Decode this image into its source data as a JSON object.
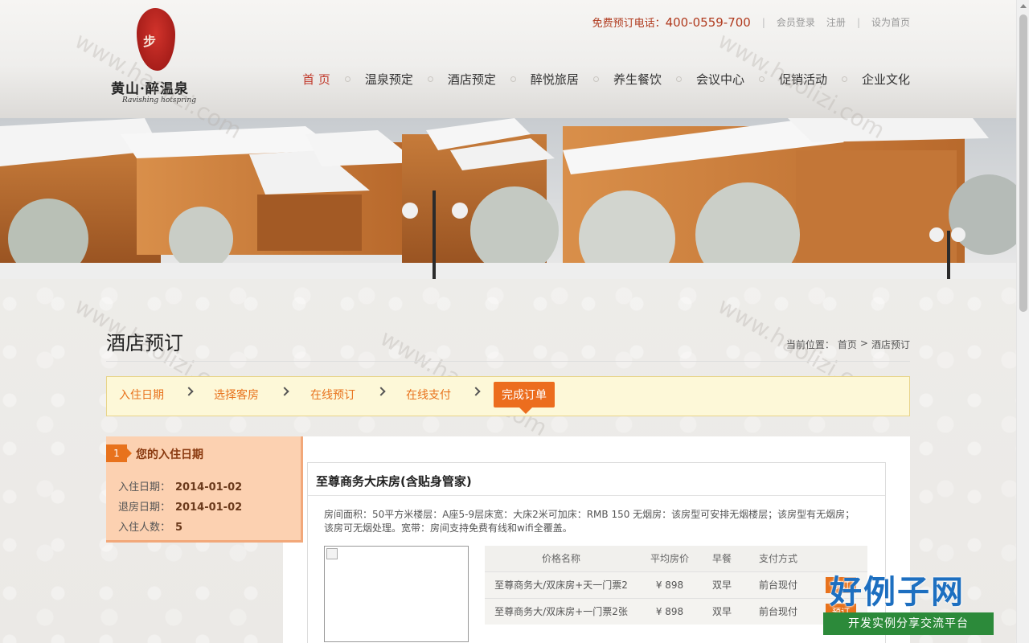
{
  "header": {
    "logo_seal_text": "步",
    "logo_cn": "黄山·醉温泉",
    "logo_en": "Ravishing hotspring",
    "hotline_label": "免费预订电话：",
    "hotline_number": "400-0559-700",
    "links": [
      "会员登录",
      "注册",
      "设为首页"
    ],
    "nav": [
      "首 页",
      "温泉预定",
      "酒店预定",
      "醉悦旅居",
      "养生餐饮",
      "会议中心",
      "促销活动",
      "企业文化"
    ],
    "nav_active": 0
  },
  "page": {
    "title": "酒店预订",
    "breadcrumb_label": "当前位置：",
    "breadcrumb_home": "首页",
    "breadcrumb_sep": ">",
    "breadcrumb_current": "酒店预订"
  },
  "steps": [
    "入住日期",
    "选择客房",
    "在线预订",
    "在线支付",
    "完成订单"
  ],
  "sidebar": {
    "number": "1",
    "title": "您的入住日期",
    "rows": [
      {
        "label": "入住日期：",
        "value": "2014-01-02"
      },
      {
        "label": "退房日期：",
        "value": "2014-01-02"
      },
      {
        "label": "入住人数：",
        "value": "5"
      }
    ]
  },
  "room": {
    "name": "至尊商务大床房(含贴身管家)",
    "description": "房间面积：50平方米楼层：A座5-9层床宽：大床2米可加床：RMB 150 无烟房：该房型可安排无烟楼层；该房型有无烟房；该房可无烟处理。宽带：房间支持免费有线和wifi全覆盖。",
    "table_headers": [
      "价格名称",
      "平均房价",
      "早餐",
      "支付方式",
      ""
    ],
    "rows": [
      {
        "name": "至尊商务大/双床房+天一门票2",
        "price": "¥ 898",
        "breakfast": "双早",
        "payment": "前台现付",
        "action": "预订"
      },
      {
        "name": "至尊商务大/双床房+一门票2张",
        "price": "¥ 898",
        "breakfast": "双早",
        "payment": "前台现付",
        "action": "预订"
      }
    ]
  },
  "watermark": "www.haolizi.com",
  "badge": {
    "top": "好例子网",
    "bottom": "开发实例分享交流平台"
  },
  "colors": {
    "accent": "#e8721c",
    "nav_active": "#c0392b",
    "hotline": "#b03a1e"
  }
}
